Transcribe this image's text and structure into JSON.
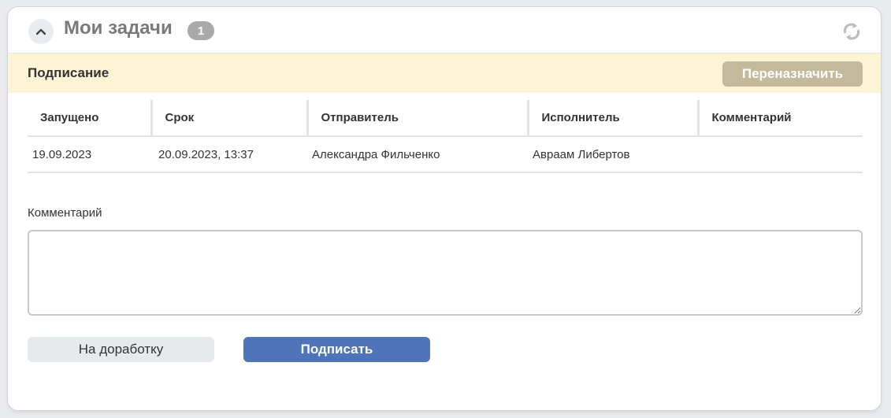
{
  "header": {
    "title": "Мои задачи",
    "count": "1"
  },
  "section": {
    "title": "Подписание",
    "reassign_label": "Переназначить"
  },
  "table": {
    "columns": [
      "Запущено",
      "Срок",
      "Отправитель",
      "Исполнитель",
      "Комментарий"
    ],
    "rows": [
      [
        "19.09.2023",
        "20.09.2023, 13:37",
        "Александра Фильченко",
        "Авраам Либертов",
        ""
      ]
    ]
  },
  "comment": {
    "label": "Комментарий",
    "value": "",
    "placeholder": ""
  },
  "actions": {
    "rework_label": "На доработку",
    "sign_label": "Подписать"
  },
  "colors": {
    "accent": "#4f74b9",
    "section_bg": "#fdf4d6",
    "reassign_bg": "#c5b99c",
    "badge_bg": "#a9a9a9"
  },
  "icons": {
    "collapse": "chevron-up-icon",
    "refresh": "refresh-icon"
  }
}
